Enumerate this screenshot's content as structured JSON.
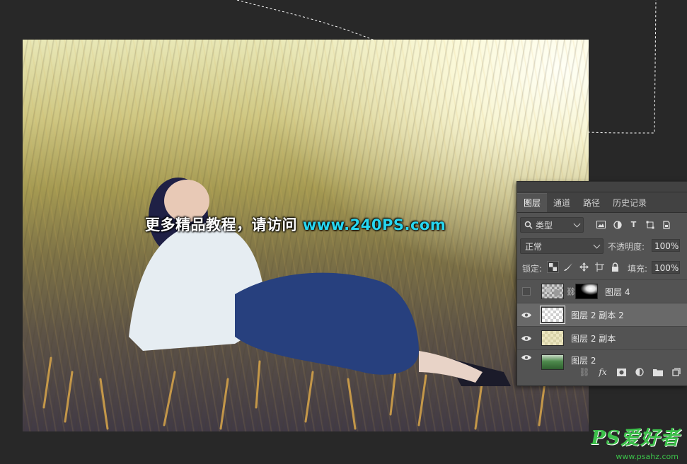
{
  "watermark": {
    "text": "更多精品教程，请访问",
    "url": "www.240PS.com"
  },
  "layers_panel": {
    "tabs": [
      {
        "label": "图层",
        "active": true
      },
      {
        "label": "通道",
        "active": false
      },
      {
        "label": "路径",
        "active": false
      },
      {
        "label": "历史记录",
        "active": false
      }
    ],
    "filter": {
      "label": "类型",
      "icon": "search-icon"
    },
    "blend_mode": "正常",
    "opacity_label": "不透明度:",
    "opacity_value": "100%",
    "lock_label": "锁定:",
    "fill_label": "填充:",
    "fill_value": "100%",
    "layers": [
      {
        "name": "图层 4",
        "visible": false,
        "selected": false,
        "has_mask": true
      },
      {
        "name": "图层 2 副本 2",
        "visible": true,
        "selected": true,
        "has_mask": false
      },
      {
        "name": "图层 2 副本",
        "visible": true,
        "selected": false,
        "has_mask": false
      },
      {
        "name": "图层 2",
        "visible": true,
        "selected": false,
        "has_mask": false
      }
    ],
    "footer_icons": [
      "link-icon",
      "fx-icon",
      "add-mask-icon",
      "adjustment-icon",
      "folder-icon",
      "new-layer-icon"
    ]
  },
  "site_logo": {
    "text": "PS爱好者",
    "url": "www.psahz.com",
    "color": "#3cc04a"
  },
  "colors": {
    "workspace": "#282828",
    "panel": "#535353",
    "url_accent": "#27d6f0"
  }
}
